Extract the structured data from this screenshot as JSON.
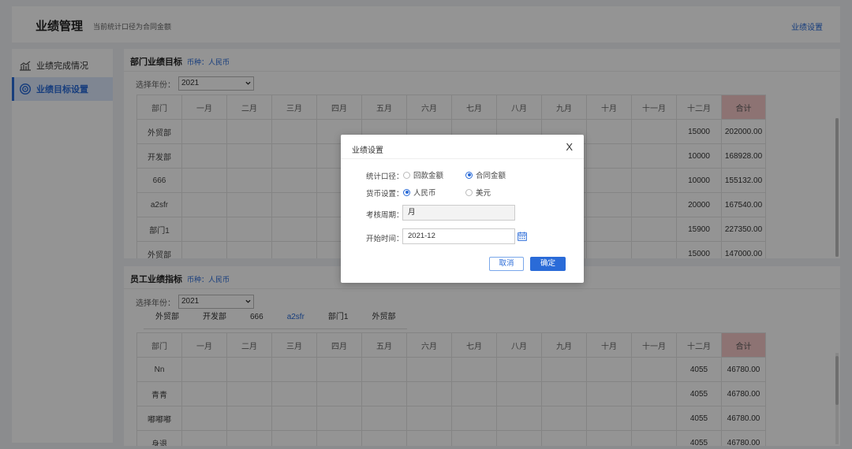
{
  "header": {
    "title": "业绩管理",
    "subtitle": "当前统计口径为合同金额",
    "settings_link": "业绩设置"
  },
  "sidebar": {
    "items": [
      {
        "label": "业绩完成情况",
        "icon": "chart-line-icon",
        "active": false
      },
      {
        "label": "业绩目标设置",
        "icon": "target-icon",
        "active": true
      }
    ]
  },
  "dept_panel": {
    "title": "部门业绩目标",
    "currency": "币种：人民币",
    "year_label": "选择年份：",
    "year_value": "2021",
    "columns": [
      "部门",
      "一月",
      "二月",
      "三月",
      "四月",
      "五月",
      "六月",
      "七月",
      "八月",
      "九月",
      "十月",
      "十一月",
      "十二月",
      "合计"
    ],
    "rows": [
      {
        "name": "外贸部",
        "dec": "15000",
        "total": "202000.00"
      },
      {
        "name": "开发部",
        "dec": "10000",
        "total": "168928.00"
      },
      {
        "name": "666",
        "dec": "10000",
        "total": "155132.00"
      },
      {
        "name": "a2sfr",
        "dec": "20000",
        "total": "167540.00"
      },
      {
        "name": "部门1",
        "dec": "15900",
        "total": "227350.00"
      },
      {
        "name": "外贸部",
        "dec": "15000",
        "total": "147000.00"
      }
    ]
  },
  "emp_panel": {
    "title": "员工业绩指标",
    "currency": "币种：人民币",
    "year_label": "选择年份：",
    "year_value": "2021",
    "tabs": [
      "外贸部",
      "开发部",
      "666",
      "a2sfr",
      "部门1",
      "外贸部"
    ],
    "active_tab": 3,
    "columns": [
      "部门",
      "一月",
      "二月",
      "三月",
      "四月",
      "五月",
      "六月",
      "七月",
      "八月",
      "九月",
      "十月",
      "十一月",
      "十二月",
      "合计"
    ],
    "rows": [
      {
        "name": "Nn",
        "dec": "4055",
        "total": "46780.00"
      },
      {
        "name": "青青",
        "dec": "4055",
        "total": "46780.00"
      },
      {
        "name": "嘟嘟嘟",
        "dec": "4055",
        "total": "46780.00"
      },
      {
        "name": "身退",
        "dec": "4055",
        "total": "46780.00"
      }
    ]
  },
  "modal": {
    "title": "业绩设置",
    "close": "X",
    "stat_label": "统计口径：",
    "stat_options": [
      "回款金额",
      "合同金额"
    ],
    "stat_selected": 1,
    "currency_label": "货币设置：",
    "currency_options": [
      "人民币",
      "美元"
    ],
    "currency_selected": 0,
    "period_label": "考核周期：",
    "period_value": "月",
    "start_label": "开始时间：",
    "start_value": "2021-12",
    "cancel_label": "取消",
    "ok_label": "确定"
  },
  "colors": {
    "accent": "#2a6bd8",
    "total_header": "#f3c6c6",
    "overlay": "rgba(0,0,0,0.42)"
  }
}
